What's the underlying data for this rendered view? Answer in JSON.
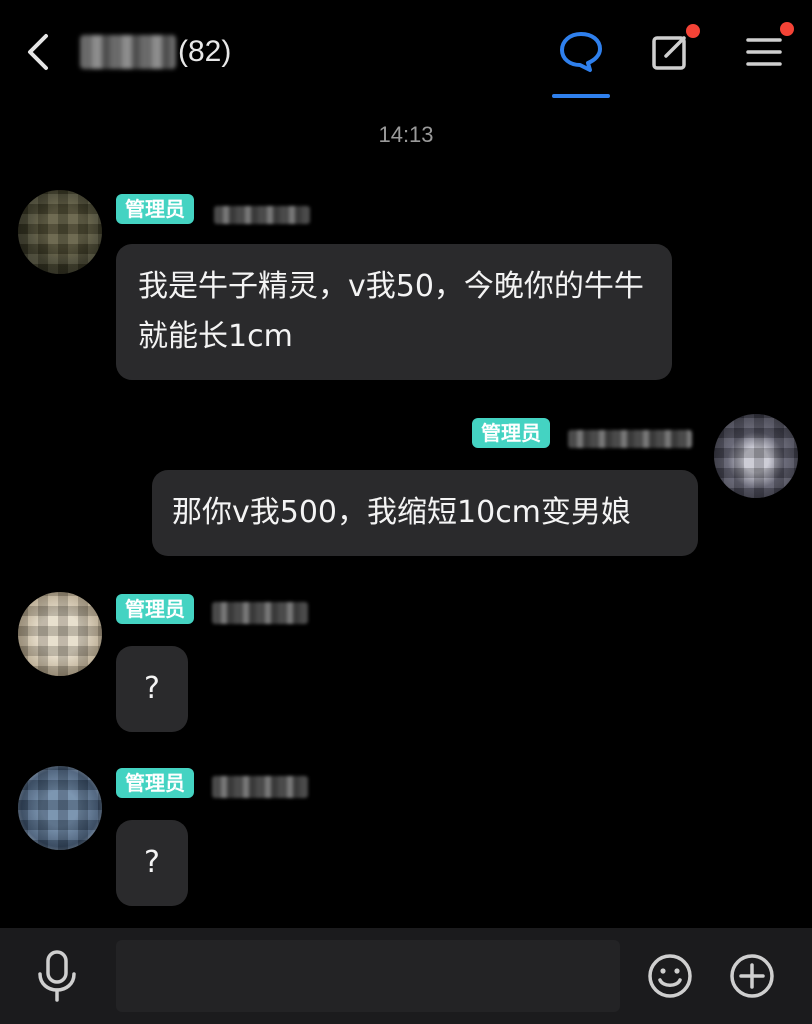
{
  "header": {
    "group_name_blurred": "",
    "member_count": "(82)"
  },
  "timestamp": "14:13",
  "messages": [
    {
      "side": "left",
      "role_badge": "管理员",
      "text": "我是牛子精灵，v我50，今晚你的牛牛就能长1cm"
    },
    {
      "side": "right",
      "role_badge": "管理员",
      "text": "那你v我500，我缩短10cm变男娘"
    },
    {
      "side": "left",
      "role_badge": "管理员",
      "text": "?"
    },
    {
      "side": "left",
      "role_badge": "管理员",
      "text": "?"
    }
  ],
  "input": {
    "value": "",
    "placeholder": ""
  },
  "icons": {
    "back": "chevron-left-icon",
    "chat": "chat-bubble-icon",
    "edit": "edit-icon",
    "menu": "hamburger-menu-icon",
    "mic": "microphone-icon",
    "emoji": "smiley-icon",
    "plus": "plus-circle-icon"
  },
  "colors": {
    "background": "#000000",
    "bubble": "#2a2a2c",
    "badge": "#44d3c2",
    "accent": "#2f80ed",
    "notification_dot": "#f44336",
    "bottom_bar": "#1b1b1d"
  }
}
